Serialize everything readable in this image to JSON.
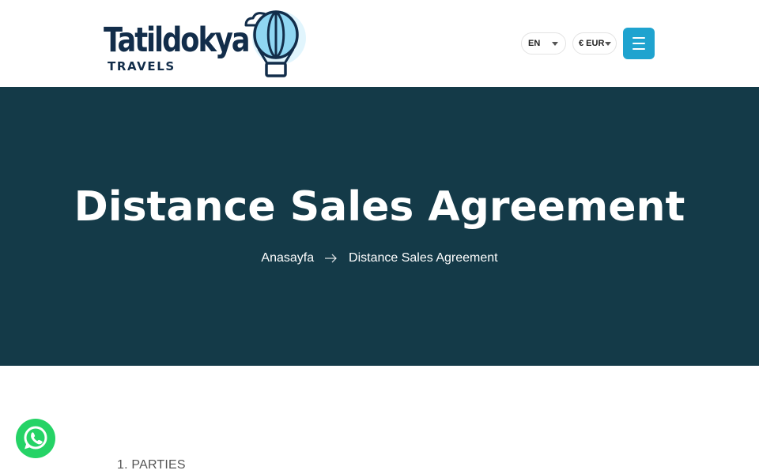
{
  "header": {
    "logo": {
      "name": "Tatildokya",
      "tagline": "TRAVELS"
    },
    "language": {
      "selected": "EN"
    },
    "currency": {
      "selected": "€ EUR"
    },
    "menu_icon": "hamburger-icon"
  },
  "hero": {
    "title": "Distance Sales Agreement",
    "breadcrumb": [
      {
        "label": "Anasayfa"
      },
      {
        "label": "Distance Sales Agreement"
      }
    ],
    "separator_icon": "arrow-right-icon"
  },
  "content": {
    "section_title": "1. PARTIES"
  },
  "floating": {
    "whatsapp_icon": "whatsapp-icon"
  },
  "colors": {
    "hero_bg": "#143a48",
    "accent": "#1fa3cf",
    "brand_dark": "#122d4a",
    "whatsapp": "#25d366"
  }
}
